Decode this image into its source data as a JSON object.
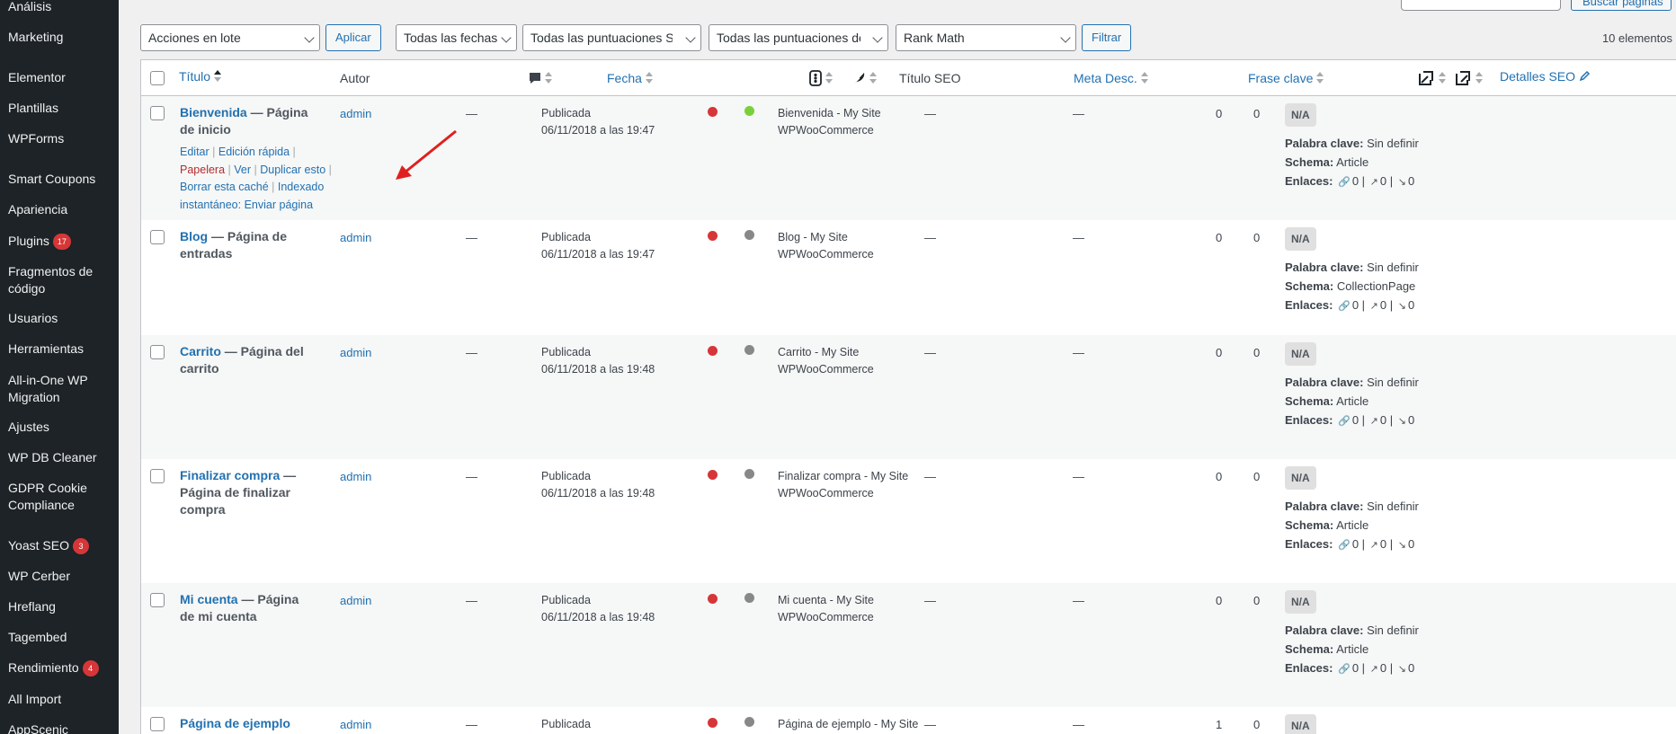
{
  "sidebar": {
    "items": [
      {
        "label": "Análisis",
        "badge": ""
      },
      {
        "label": "Marketing",
        "badge": ""
      },
      {
        "label": "Elementor",
        "badge": ""
      },
      {
        "label": "Plantillas",
        "badge": ""
      },
      {
        "label": "WPForms",
        "badge": ""
      },
      {
        "label": "Smart Coupons",
        "badge": ""
      },
      {
        "label": "Apariencia",
        "badge": ""
      },
      {
        "label": "Plugins",
        "badge": "17"
      },
      {
        "label": "Fragmentos de código",
        "badge": ""
      },
      {
        "label": "Usuarios",
        "badge": ""
      },
      {
        "label": "Herramientas",
        "badge": ""
      },
      {
        "label": "All-in-One WP Migration",
        "badge": ""
      },
      {
        "label": "Ajustes",
        "badge": ""
      },
      {
        "label": "WP DB Cleaner",
        "badge": ""
      },
      {
        "label": "GDPR Cookie Compliance",
        "badge": ""
      },
      {
        "label": "Yoast SEO",
        "badge": "3"
      },
      {
        "label": "WP Cerber",
        "badge": ""
      },
      {
        "label": "Hreflang",
        "badge": ""
      },
      {
        "label": "Tagembed",
        "badge": ""
      },
      {
        "label": "Rendimiento",
        "badge": "4"
      },
      {
        "label": "All Import",
        "badge": ""
      },
      {
        "label": "AppScenic",
        "badge": ""
      }
    ]
  },
  "top": {
    "search_button": "Buscar páginas"
  },
  "filters": {
    "bulk_action": "Acciones en lote",
    "apply": "Aplicar",
    "dates": "Todas las fechas",
    "seo_scores": "Todas las puntuaciones SEO",
    "readability_scores": "Todas las puntuaciones de legibilidad",
    "rank_math": "Rank Math",
    "filter": "Filtrar",
    "count": "10 elementos"
  },
  "columns": {
    "title": "Título",
    "author": "Autor",
    "date": "Fecha",
    "seo_title": "Título SEO",
    "meta_desc": "Meta Desc.",
    "keyphrase": "Frase clave",
    "seo_details": "Detalles SEO"
  },
  "row_actions": {
    "edit": "Editar",
    "quick_edit": "Edición rápida",
    "trash": "Papelera",
    "view": "Ver",
    "duplicate": "Duplicar esto",
    "clear_cache": "Borrar esta caché",
    "instant_index_1": "Indexado",
    "instant_index_2": "instantáneo: Enviar página"
  },
  "seo_labels": {
    "na": "N/A",
    "keyword": "Palabra clave:",
    "schema": "Schema:",
    "links": "Enlaces:",
    "undefined": "Sin definir"
  },
  "rows": [
    {
      "title": "Bienvenida",
      "extra": " — Página de inicio",
      "author": "admin",
      "comments": "—",
      "status": "Publicada",
      "date": "06/11/2018 a las 19:47",
      "seo_dot": "#d63638",
      "read_dot": "#7ad03a",
      "seo_title_1": "Bienvenida - My Site",
      "seo_title_2": "WPWooCommerce",
      "meta": "—",
      "keyphrase": "—",
      "links_in": "0",
      "links_out": "0",
      "schema": "Article",
      "l1": "0",
      "l2": "0",
      "l3": "0"
    },
    {
      "title": "Blog",
      "extra": " — Página de entradas",
      "author": "admin",
      "comments": "—",
      "status": "Publicada",
      "date": "06/11/2018 a las 19:47",
      "seo_dot": "#d63638",
      "read_dot": "#888888",
      "seo_title_1": "Blog - My Site",
      "seo_title_2": "WPWooCommerce",
      "meta": "—",
      "keyphrase": "—",
      "links_in": "0",
      "links_out": "0",
      "schema": "CollectionPage",
      "l1": "0",
      "l2": "0",
      "l3": "0"
    },
    {
      "title": "Carrito",
      "extra": " — Página del carrito",
      "author": "admin",
      "comments": "—",
      "status": "Publicada",
      "date": "06/11/2018 a las 19:48",
      "seo_dot": "#d63638",
      "read_dot": "#888888",
      "seo_title_1": "Carrito - My Site",
      "seo_title_2": "WPWooCommerce",
      "meta": "—",
      "keyphrase": "—",
      "links_in": "0",
      "links_out": "0",
      "schema": "Article",
      "l1": "0",
      "l2": "0",
      "l3": "0"
    },
    {
      "title": "Finalizar compra",
      "extra": " — Página de finalizar compra",
      "author": "admin",
      "comments": "—",
      "status": "Publicada",
      "date": "06/11/2018 a las 19:48",
      "seo_dot": "#d63638",
      "read_dot": "#888888",
      "seo_title_1": "Finalizar compra - My Site",
      "seo_title_2": "WPWooCommerce",
      "meta": "—",
      "keyphrase": "—",
      "links_in": "0",
      "links_out": "0",
      "schema": "Article",
      "l1": "0",
      "l2": "0",
      "l3": "0"
    },
    {
      "title": "Mi cuenta",
      "extra": " — Página de mi cuenta",
      "author": "admin",
      "comments": "—",
      "status": "Publicada",
      "date": "06/11/2018 a las 19:48",
      "seo_dot": "#d63638",
      "read_dot": "#888888",
      "seo_title_1": "Mi cuenta - My Site",
      "seo_title_2": "WPWooCommerce",
      "meta": "—",
      "keyphrase": "—",
      "links_in": "0",
      "links_out": "0",
      "schema": "Article",
      "l1": "0",
      "l2": "0",
      "l3": "0"
    },
    {
      "title": "Página de ejemplo",
      "extra": "",
      "author": "admin",
      "comments": "—",
      "status": "Publicada",
      "date": "",
      "seo_dot": "#d63638",
      "read_dot": "#888888",
      "seo_title_1": "Página de ejemplo - My Site",
      "seo_title_2": "",
      "meta": "—",
      "keyphrase": "—",
      "links_in": "1",
      "links_out": "0",
      "schema": "",
      "l1": "",
      "l2": "",
      "l3": ""
    }
  ],
  "colors": {
    "accent": "#2271b1",
    "sidebar_bg": "#1d2327",
    "badge": "#d63638",
    "arrow": "#e02020"
  }
}
